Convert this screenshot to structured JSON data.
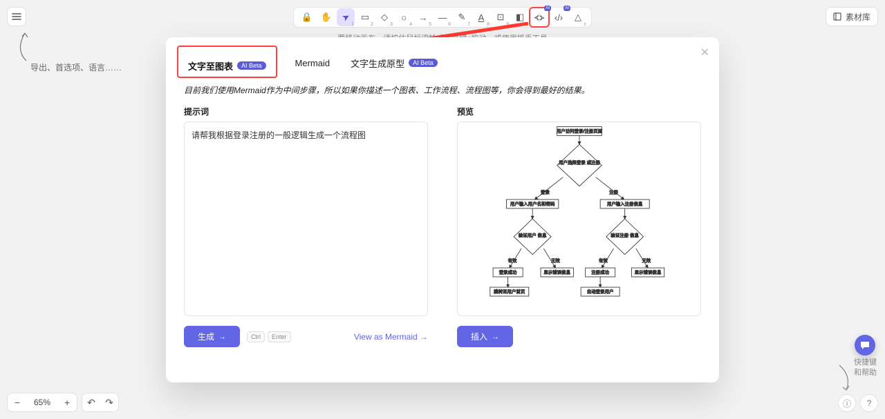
{
  "topMenu": {
    "icon": "menu"
  },
  "materialLib": {
    "label": "素材库"
  },
  "toolbar": {
    "tools": [
      {
        "name": "lock-tool",
        "glyph": "🔒",
        "idx": ""
      },
      {
        "name": "hand-tool",
        "glyph": "✋",
        "idx": ""
      },
      {
        "name": "select-tool",
        "glyph": "▲",
        "idx": "1",
        "active": true
      },
      {
        "name": "rectangle-tool",
        "glyph": "▭",
        "idx": "2"
      },
      {
        "name": "diamond-tool",
        "glyph": "◇",
        "idx": "3"
      },
      {
        "name": "ellipse-tool",
        "glyph": "○",
        "idx": "4"
      },
      {
        "name": "arrow-tool",
        "glyph": "→",
        "idx": "5"
      },
      {
        "name": "line-tool",
        "glyph": "—",
        "idx": "6"
      },
      {
        "name": "draw-tool",
        "glyph": "✎",
        "idx": "7"
      },
      {
        "name": "text-tool",
        "glyph": "A",
        "idx": "8"
      },
      {
        "name": "image-tool",
        "glyph": "⊡",
        "idx": "9"
      },
      {
        "name": "eraser-tool",
        "glyph": "◧",
        "idx": "0"
      },
      {
        "name": "ai-diagram-tool",
        "glyph": "⦓⦔",
        "idx": "",
        "ai": true,
        "highlight": true
      },
      {
        "name": "ai-code-tool",
        "glyph": "‹/›",
        "idx": "",
        "ai": true
      },
      {
        "name": "shapes-tool",
        "glyph": "△",
        "idx": "c"
      }
    ]
  },
  "canvasHint": "要移动画布，请按住鼠标滚轮或空格键+拖动，或使用抓手工具",
  "annotation1": "导出、首选项、语言……",
  "modal": {
    "tabs": {
      "textToDiagram": {
        "label": "文字至图表",
        "badge": "AI Beta"
      },
      "mermaid": {
        "label": "Mermaid"
      },
      "textToProto": {
        "label": "文字生成原型",
        "badge": "AI Beta"
      }
    },
    "note": "目前我们使用Mermaid作为中间步骤，所以如果你描述一个图表、工作流程、流程图等，你会得到最好的结果。",
    "promptHeader": "提示词",
    "promptValue": "请帮我根据登录注册的一般逻辑生成一个流程图",
    "previewHeader": "预览",
    "generateBtn": "生成",
    "kbd1": "Ctrl",
    "kbd2": "Enter",
    "viewAsMermaid": "View as Mermaid  →",
    "insertBtn": "插入",
    "flow": {
      "n1": "用户访问登录/注册页面",
      "n2": "用户选择登录\n或注册",
      "e_login": "登录",
      "e_register": "注册",
      "n3": "用户输入用户名和密码",
      "n4": "用户输入注册信息",
      "n5": "验证用户\n信息",
      "n6": "验证注册\n信息",
      "e_valid": "有效",
      "e_invalid": "无效",
      "n7": "登录成功",
      "n8": "显示错误信息",
      "n9": "注册成功",
      "n10": "显示错误信息",
      "n11": "跳转至用户首页",
      "n12": "自动登录用户"
    }
  },
  "zoom": {
    "minus": "−",
    "pct": "65%",
    "plus": "+",
    "undo": "↶",
    "redo": "↷"
  },
  "bottomRight": {
    "chat": "💬",
    "label": "快捷键\n和帮助",
    "info": "ⓘ",
    "help": "?"
  }
}
